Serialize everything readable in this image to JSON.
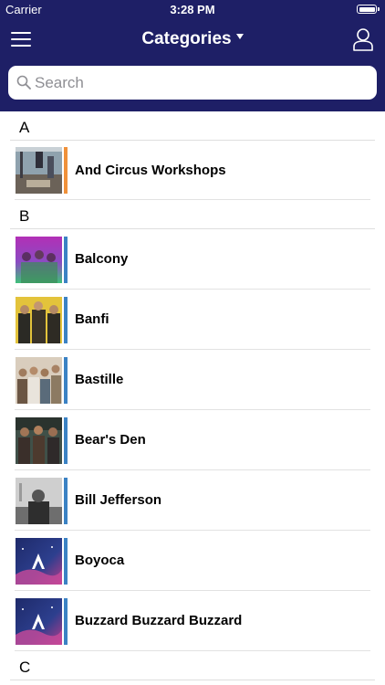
{
  "status_bar": {
    "carrier": "Carrier",
    "time": "3:28 PM"
  },
  "nav": {
    "title": "Categories",
    "menu_icon": "hamburger-menu-icon",
    "user_icon": "user-profile-icon",
    "title_caret": "caret-down-icon"
  },
  "search": {
    "placeholder": "Search",
    "value": "",
    "icon": "search-icon"
  },
  "colors": {
    "header_bg": "#1e1f66",
    "accent_orange": "#f0913a",
    "accent_blue": "#3b82c4"
  },
  "sections": [
    {
      "letter": "A",
      "items": [
        {
          "label": "And Circus Workshops",
          "accent": "orange"
        }
      ]
    },
    {
      "letter": "B",
      "items": [
        {
          "label": "Balcony",
          "accent": "blue"
        },
        {
          "label": "Banfi",
          "accent": "blue"
        },
        {
          "label": "Bastille",
          "accent": "blue"
        },
        {
          "label": "Bear's Den",
          "accent": "blue"
        },
        {
          "label": "Bill Jefferson",
          "accent": "blue"
        },
        {
          "label": "Boyoca",
          "accent": "blue"
        },
        {
          "label": "Buzzard Buzzard Buzzard",
          "accent": "blue"
        }
      ]
    },
    {
      "letter": "C",
      "items": []
    }
  ]
}
